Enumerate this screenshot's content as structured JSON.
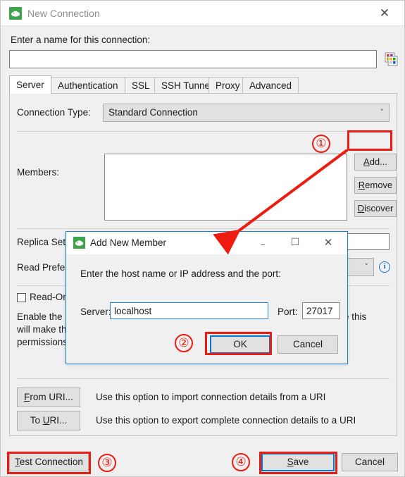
{
  "window": {
    "title": "New Connection",
    "icon": "mongodb-leaf-icon",
    "close_label": "✕"
  },
  "form": {
    "name_label": "Enter a name for this connection:",
    "name_value": "",
    "name_placeholder": "",
    "palette_icon": "color-palette-icon"
  },
  "tabs": [
    {
      "label": "Server",
      "active": true
    },
    {
      "label": "Authentication",
      "active": false
    },
    {
      "label": "SSL",
      "active": false
    },
    {
      "label": "SSH Tunnel",
      "active": false
    },
    {
      "label": "Proxy",
      "active": false
    },
    {
      "label": "Advanced",
      "active": false
    }
  ],
  "server_tab": {
    "connection_type_label": "Connection Type:",
    "connection_type_value": "Standard Connection",
    "connection_type_options": [
      "Standard Connection"
    ],
    "members_label": "Members:",
    "members_items": [],
    "buttons": {
      "add": "Add...",
      "remove": "Remove",
      "discover": "Discover"
    },
    "replica_set_label": "Replica Set Name:",
    "replica_set_value": "",
    "read_pref_label": "Read Prefer",
    "read_pref_value": "",
    "info_icon": "info-icon",
    "read_only_label": "Read-On",
    "read_only_checked": false,
    "help_line_1": "Enable the",
    "help_line_1_tail": "e this",
    "help_line_2": "will make th",
    "help_line_3": "permissions"
  },
  "uri": {
    "from_button": "From URI...",
    "from_button_mnemonic": "F",
    "from_desc": "Use this option to import connection details from a URI",
    "to_button": "To URI...",
    "to_button_mnemonic": "U",
    "to_desc": "Use this option to export complete connection details to a URI"
  },
  "footer": {
    "test_connection": "Test Connection",
    "save": "Save",
    "cancel": "Cancel"
  },
  "dialog": {
    "title": "Add New Member",
    "icon": "mongodb-leaf-icon",
    "minimize": "–",
    "maximize": "☐",
    "close": "✕",
    "prompt": "Enter the host name or IP address and the port:",
    "server_label": "Server:",
    "server_value": "localhost",
    "port_label": "Port:",
    "port_value": "27017",
    "ok": "OK",
    "cancel": "Cancel"
  },
  "annotations": {
    "colors": {
      "highlight": "#ee1b11",
      "focus": "#0078d7"
    },
    "markers": [
      {
        "number": "①",
        "target": "add-button"
      },
      {
        "number": "②",
        "target": "dialog-ok-button"
      },
      {
        "number": "③",
        "target": "test-connection-button"
      },
      {
        "number": "④",
        "target": "save-button"
      }
    ]
  }
}
